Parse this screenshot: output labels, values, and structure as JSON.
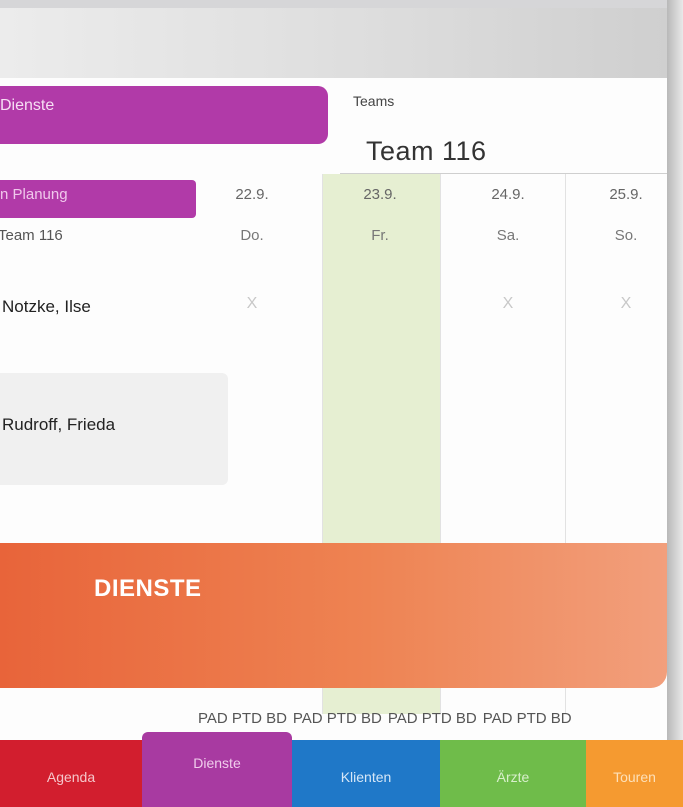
{
  "header": {
    "section_title": "Dienste",
    "teams_label": "Teams",
    "team_title": "Team 116"
  },
  "filter": {
    "planung_label": "n Planung",
    "team_label": "Team 116"
  },
  "columns": [
    {
      "date": "22.9.",
      "day": "Do."
    },
    {
      "date": "23.9.",
      "day": "Fr."
    },
    {
      "date": "24.9.",
      "day": "Sa."
    },
    {
      "date": "25.9.",
      "day": "So."
    }
  ],
  "rows": [
    {
      "name": "Notzke, Ilse",
      "marks": [
        "X",
        "",
        "X",
        "X"
      ]
    },
    {
      "name": "Rudroff, Frieda",
      "marks": [
        "",
        "",
        "",
        ""
      ]
    }
  ],
  "banner": {
    "text": "DIENSTE"
  },
  "legend": [
    "PAD PTD BD",
    "PAD PTD BD",
    "PAD PTD BD",
    "PAD PTD BD"
  ],
  "tabs": [
    {
      "label": "Agenda",
      "color": "#d21e2e"
    },
    {
      "label": "Dienste",
      "color": "#a83aa1"
    },
    {
      "label": "Klienten",
      "color": "#1f78c8"
    },
    {
      "label": "Ärzte",
      "color": "#6fbc4a"
    },
    {
      "label": "Touren",
      "color": "#f59a30"
    }
  ],
  "colors": {
    "accent_purple": "#b13aa8",
    "banner_orange": "#e8643a",
    "highlight_green": "#e6efd2"
  }
}
